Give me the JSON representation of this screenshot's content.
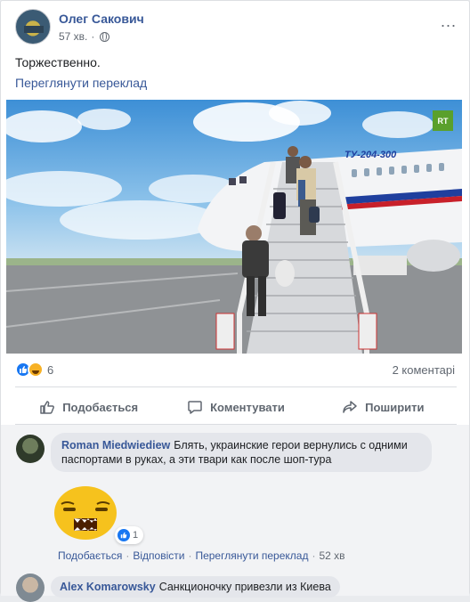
{
  "post": {
    "author": "Олег Сакович",
    "time": "57 хв.",
    "text": "Торжественно.",
    "see_translation": "Переглянути переклад",
    "more_label": "...",
    "photo_watermark": "RT",
    "aircraft_label": "ТУ-204-300"
  },
  "reactions": {
    "count": "6",
    "comments_count": "2 коментарі"
  },
  "actions": {
    "like": "Подобається",
    "comment": "Коментувати",
    "share": "Поширити"
  },
  "comments": [
    {
      "author": "Roman Miedwiediew",
      "text": "Блять, украинские герои вернулись с одними паспортами в руках, а эти твари как после шоп-тура",
      "sticker_reactions": "1",
      "links": {
        "like": "Подобається",
        "reply": "Відповісти",
        "translate": "Переглянути переклад",
        "time": "52 хв"
      }
    },
    {
      "author": "Alex Komarowsky",
      "text": "Санкционочку привезли из Киева"
    }
  ],
  "colors": {
    "link_blue": "#385898",
    "like_blue": "#1877f2",
    "gray_text": "#606770",
    "sticker_yellow": "#f6c21d"
  }
}
